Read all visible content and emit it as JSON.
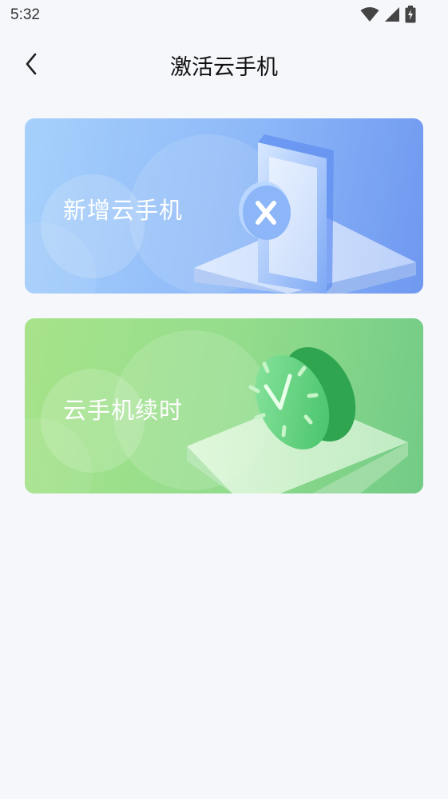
{
  "status_bar": {
    "time": "5:32",
    "icons": [
      "wifi-icon",
      "cellular-signal-icon",
      "battery-charging-icon"
    ]
  },
  "header": {
    "back_icon": "chevron-left-icon",
    "title": "激活云手机"
  },
  "cards": [
    {
      "label": "新增云手机",
      "illustration": "phone-add-icon",
      "color": "#8db8f8"
    },
    {
      "label": "云手机续时",
      "illustration": "clock-icon",
      "color": "#94dd8c"
    }
  ],
  "colors": {
    "background": "#f6f7fb",
    "title_text": "#111111",
    "card_text": "#ffffff"
  }
}
